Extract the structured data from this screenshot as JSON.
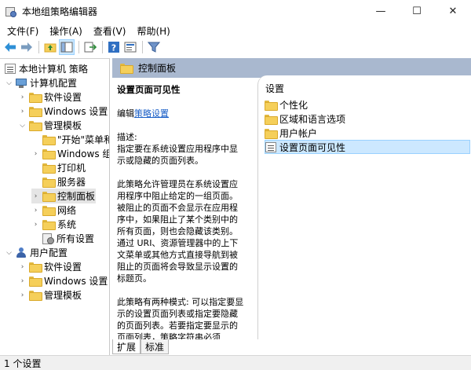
{
  "window": {
    "title": "本地组策略编辑器",
    "min_symbol": "—",
    "max_symbol": "☐",
    "close_symbol": "✕"
  },
  "menu": [
    "文件(F)",
    "操作(A)",
    "查看(V)",
    "帮助(H)"
  ],
  "toolbar": {
    "icons": [
      "back-arrow-icon",
      "forward-arrow-icon",
      "up-folder-icon",
      "show-hide-tree-icon",
      "export-list-icon",
      "help-icon",
      "properties-icon",
      "filter-icon"
    ]
  },
  "tree": {
    "root": "本地计算机 策略",
    "computer_config": "计算机配置",
    "software_settings": "软件设置",
    "windows_settings": "Windows 设置",
    "admin_templates": "管理模板",
    "start_menu": "\"开始\"菜单和",
    "windows_components": "Windows 组",
    "printers": "打印机",
    "servers": "服务器",
    "control_panel": "控制面板",
    "network": "网络",
    "system": "系统",
    "all_settings": "所有设置",
    "user_config": "用户配置",
    "user_software_settings": "软件设置",
    "user_windows_settings": "Windows 设置",
    "user_admin_templates": "管理模板"
  },
  "right_pane": {
    "header": "控制面板",
    "desc_title": "设置页面可见性",
    "edit_prefix": "编辑",
    "edit_link": "策略设置",
    "desc_label": "描述:",
    "desc_p1": "指定要在系统设置应用程序中显示或隐藏的页面列表。",
    "desc_p2": "此策略允许管理员在系统设置应用程序中阻止给定的一组页面。被阻止的页面不会显示在应用程序中，如果阻止了某个类别中的所有页面，则也会隐藏该类别。通过 URI、资源管理器中的上下文菜单或其他方式直接导航到被阻止的页面将会导致显示设置的标题页。",
    "desc_p3": "此策略有两种模式: 可以指定要显示的设置页面列表或指定要隐藏的页面列表。若要指定要显示的页面列表，策略字符串必须",
    "list_header": "设置",
    "list_items": [
      "个性化",
      "区域和语言选项",
      "用户帐户",
      "设置页面可见性"
    ]
  },
  "tabs": [
    "扩展",
    "标准"
  ],
  "status": "1 个设置"
}
